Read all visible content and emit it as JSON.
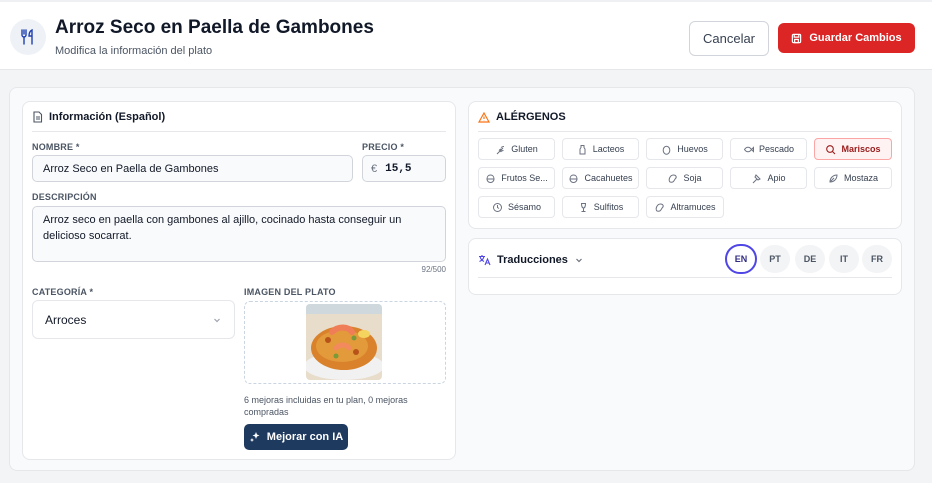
{
  "header": {
    "title": "Arroz Seco en Paella de Gambones",
    "subtitle": "Modifica la información del plato",
    "cancel_label": "Cancelar",
    "save_label": "Guardar Cambios"
  },
  "info": {
    "section_title": "Información (Español)",
    "name_label": "NOMBRE *",
    "name_value": "Arroz Seco en Paella de Gambones",
    "price_label": "PRECIO *",
    "price_currency": "€",
    "price_value": "15,5",
    "description_label": "DESCRIPCIÓN",
    "description_value": "Arroz seco en paella con gambones al ajillo, cocinado hasta conseguir un delicioso socarrat.",
    "char_counter": "92/500",
    "category_label": "CATEGORÍA *",
    "category_value": "Arroces",
    "image_label": "IMAGEN DEL PLATO",
    "plan_note": "6 mejoras incluidas en tu plan, 0 mejoras compradas",
    "ai_button_label": "Mejorar con IA"
  },
  "allergens": {
    "section_title": "ALÉRGENOS",
    "items": [
      {
        "label": "Gluten",
        "icon": "wheat-icon",
        "selected": false
      },
      {
        "label": "Lacteos",
        "icon": "milk-icon",
        "selected": false
      },
      {
        "label": "Huevos",
        "icon": "egg-icon",
        "selected": false
      },
      {
        "label": "Pescado",
        "icon": "fish-icon",
        "selected": false
      },
      {
        "label": "Mariscos",
        "icon": "shellfish-icon",
        "selected": true
      },
      {
        "label": "Frutos Se...",
        "icon": "nut-icon",
        "selected": false
      },
      {
        "label": "Cacahuetes",
        "icon": "peanut-icon",
        "selected": false
      },
      {
        "label": "Soja",
        "icon": "bean-icon",
        "selected": false
      },
      {
        "label": "Apio",
        "icon": "celery-icon",
        "selected": false
      },
      {
        "label": "Mostaza",
        "icon": "mustard-icon",
        "selected": false
      },
      {
        "label": "Sésamo",
        "icon": "sesame-icon",
        "selected": false
      },
      {
        "label": "Sulfitos",
        "icon": "wine-icon",
        "selected": false
      },
      {
        "label": "Altramuces",
        "icon": "lupin-icon",
        "selected": false
      }
    ]
  },
  "translations": {
    "title": "Traducciones",
    "languages": [
      {
        "code": "EN",
        "active": true
      },
      {
        "code": "PT",
        "active": false
      },
      {
        "code": "DE",
        "active": false
      },
      {
        "code": "IT",
        "active": false
      },
      {
        "code": "FR",
        "active": false
      }
    ]
  },
  "colors": {
    "accent_red": "#dc2626",
    "ai_button": "#1e3a5f",
    "active_language": "#4f46e5",
    "warning_icon": "#f97316"
  }
}
